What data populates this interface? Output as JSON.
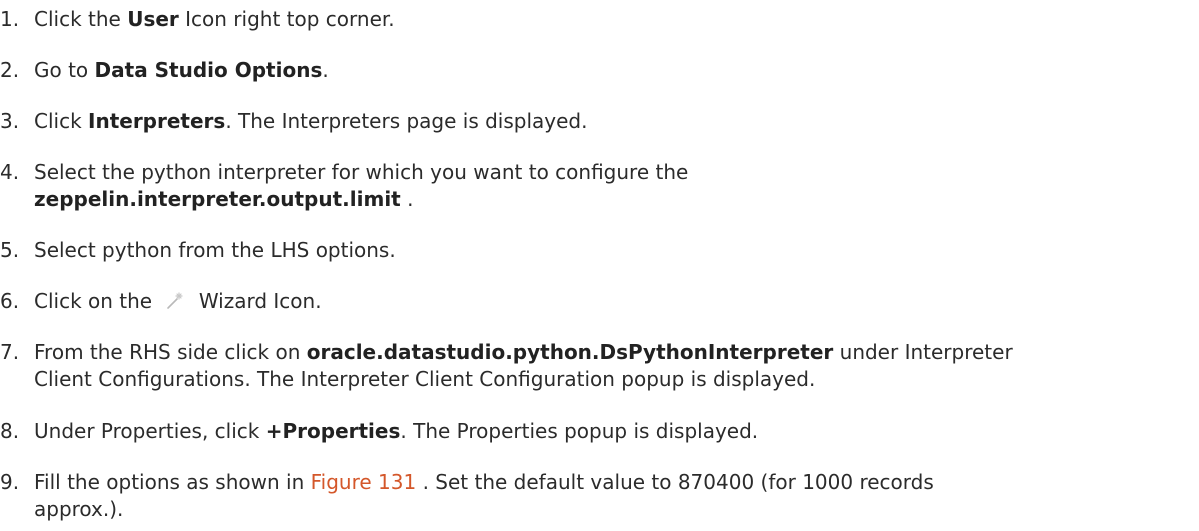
{
  "steps": [
    {
      "num": "1.",
      "pre": " Click the ",
      "bold": "User",
      "post": " Icon right top corner."
    },
    {
      "num": "2.",
      "pre": "Go to ",
      "bold": "Data Studio Options",
      "post": "."
    },
    {
      "num": "3.",
      "pre": "Click ",
      "bold": "Interpreters",
      "post": ". The Interpreters page is displayed."
    },
    {
      "num": "4.",
      "line1": "Select the python interpreter for which you want to configure the",
      "bold": "zeppelin.interpreter.output.limit",
      "post": " ."
    },
    {
      "num": "5.",
      "text": "Select python from the LHS options."
    },
    {
      "num": "6.",
      "pre": "Click on the ",
      "icon": "wizard-wand-icon",
      "post": " Wizard Icon."
    },
    {
      "num": "7.",
      "pre": "From the RHS side click on ",
      "bold": "oracle.datastudio.python.DsPythonInterpreter",
      "post": " under Interpreter",
      "line2": "Client Configurations. The Interpreter Client Configuration popup is displayed."
    },
    {
      "num": "8.",
      "pre": "Under Properties, click ",
      "bold": "+Properties",
      "post": ". The Properties popup is displayed."
    },
    {
      "num": "9.",
      "pre": "Fill the options as shown in ",
      "link": "Figure 131",
      "post": " . Set the default value to 870400 (for 1000 records",
      "line2": "approx.)."
    }
  ],
  "colors": {
    "text": "#2b2b2b",
    "link": "#d4572a"
  }
}
